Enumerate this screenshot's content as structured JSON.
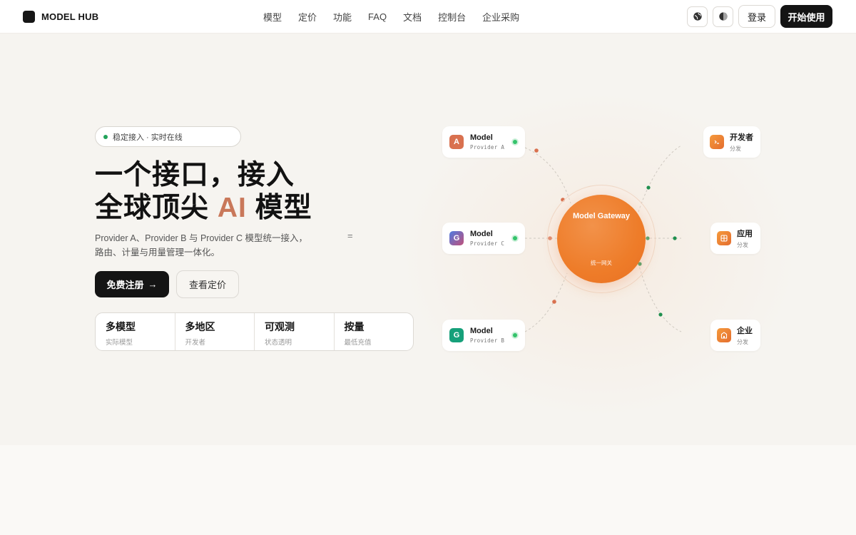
{
  "nav": {
    "brand": "MODEL HUB",
    "links": [
      "模型",
      "定价",
      "功能",
      "FAQ",
      "文档",
      "控制台",
      "企业采购"
    ],
    "login": "登录",
    "start": "开始使用"
  },
  "hero": {
    "badge": "稳定接入 · 实时在线",
    "headline_line1": "一个接口，接入",
    "headline_line2_pre": "全球顶尖 ",
    "headline_line2_accent": "AI",
    "headline_line2_post": " 模型",
    "desc_line1": "Provider A、Provider B 与 Provider C 模型统一接入，",
    "desc_line2": "路由、计量与用量管理一体化。",
    "eq_mark": "=",
    "primary_cta": "免费注册",
    "primary_cta_arrow": "→",
    "secondary_cta": "查看定价",
    "stats": [
      {
        "title": "多模型",
        "sub": "实际模型"
      },
      {
        "title": "多地区",
        "sub": "开发者"
      },
      {
        "title": "可观测",
        "sub": "状态透明"
      },
      {
        "title": "按量",
        "sub": "最低充值"
      }
    ]
  },
  "diagram": {
    "models": [
      {
        "icon_letter": "A",
        "title": "Model",
        "sub": "Provider A",
        "color": "#d9714f"
      },
      {
        "icon_letter": "G",
        "title": "Model",
        "sub": "Provider C",
        "color": "#8a63c9"
      },
      {
        "icon_letter": "G",
        "title": "Model",
        "sub": "Provider B",
        "color": "#16a07a"
      }
    ],
    "gateway": {
      "title": "Model Gateway",
      "sub": "统一网关"
    },
    "outputs": [
      {
        "title": "开发者",
        "sub": "分发",
        "icon": "terminal-icon"
      },
      {
        "title": "应用",
        "sub": "分发",
        "icon": "grid-icon"
      },
      {
        "title": "企业",
        "sub": "分发",
        "icon": "building-icon"
      }
    ],
    "colors": {
      "accent": "#ee7c29",
      "link_dot_orange": "#d9714f",
      "link_dot_green": "#1f8f4e"
    }
  }
}
